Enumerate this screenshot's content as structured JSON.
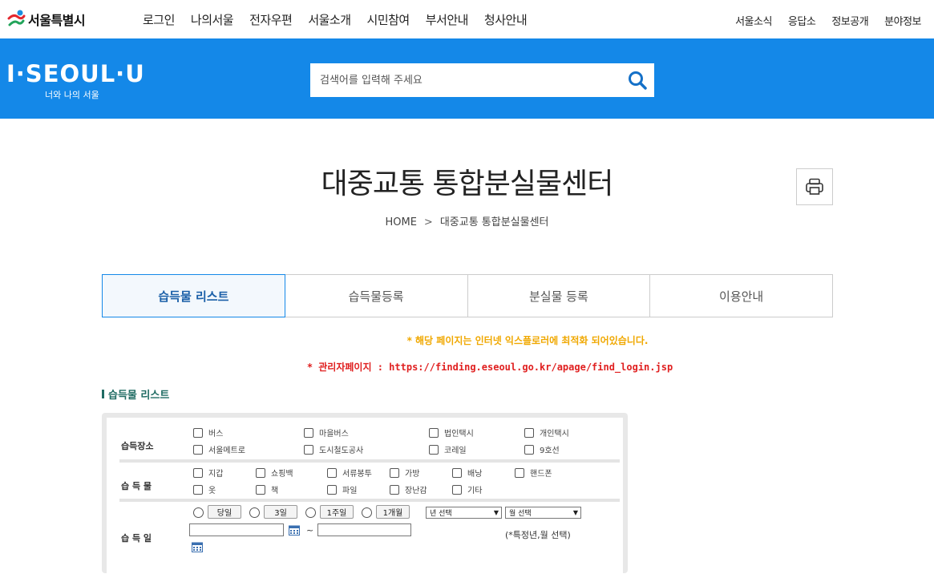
{
  "header": {
    "logo_text": "서울특별시",
    "main_nav": [
      "로그인",
      "나의서울",
      "전자우편",
      "서울소개",
      "시민참여",
      "부서안내",
      "청사안내"
    ],
    "sub_nav": [
      "서울소식",
      "응답소",
      "정보공개",
      "분야정보"
    ]
  },
  "brand": {
    "title": "I·SEOUL·U",
    "subtitle": "너와 나의 서울"
  },
  "search": {
    "placeholder": "검색어를 입력해 주세요",
    "value": ""
  },
  "page": {
    "title": "대중교통 통합분실물센터",
    "breadcrumb": [
      "HOME",
      "대중교통 통합분실물센터"
    ]
  },
  "tabs": [
    "습득물 리스트",
    "습득물등록",
    "분실물 등록",
    "이용안내"
  ],
  "notices": {
    "ie": "* 해당 페이지는 인터넷 익스플로러에 최적화 되어있습니다.",
    "admin": "* 관리자페이지 : https://finding.eseoul.go.kr/apage/find_login.jsp"
  },
  "section_title": "습득물 리스트",
  "form": {
    "place_label": "습득장소",
    "places": [
      "버스",
      "마을버스",
      "법인택시",
      "개인택시",
      "서울메트로",
      "도시철도공사",
      "코레일",
      "9호선"
    ],
    "item_label": "습 득 물",
    "items": [
      "지갑",
      "쇼핑백",
      "서류봉투",
      "가방",
      "배낭",
      "핸드폰",
      "옷",
      "책",
      "파일",
      "장난감",
      "기타"
    ],
    "date_label": "습 득 일",
    "periods": [
      "당일",
      "3일",
      "1주일",
      "1개월"
    ],
    "year_select": "년 선택",
    "month_select": "월 선택",
    "range_sep": "~",
    "hint": "(*특정년,월 선택)"
  }
}
